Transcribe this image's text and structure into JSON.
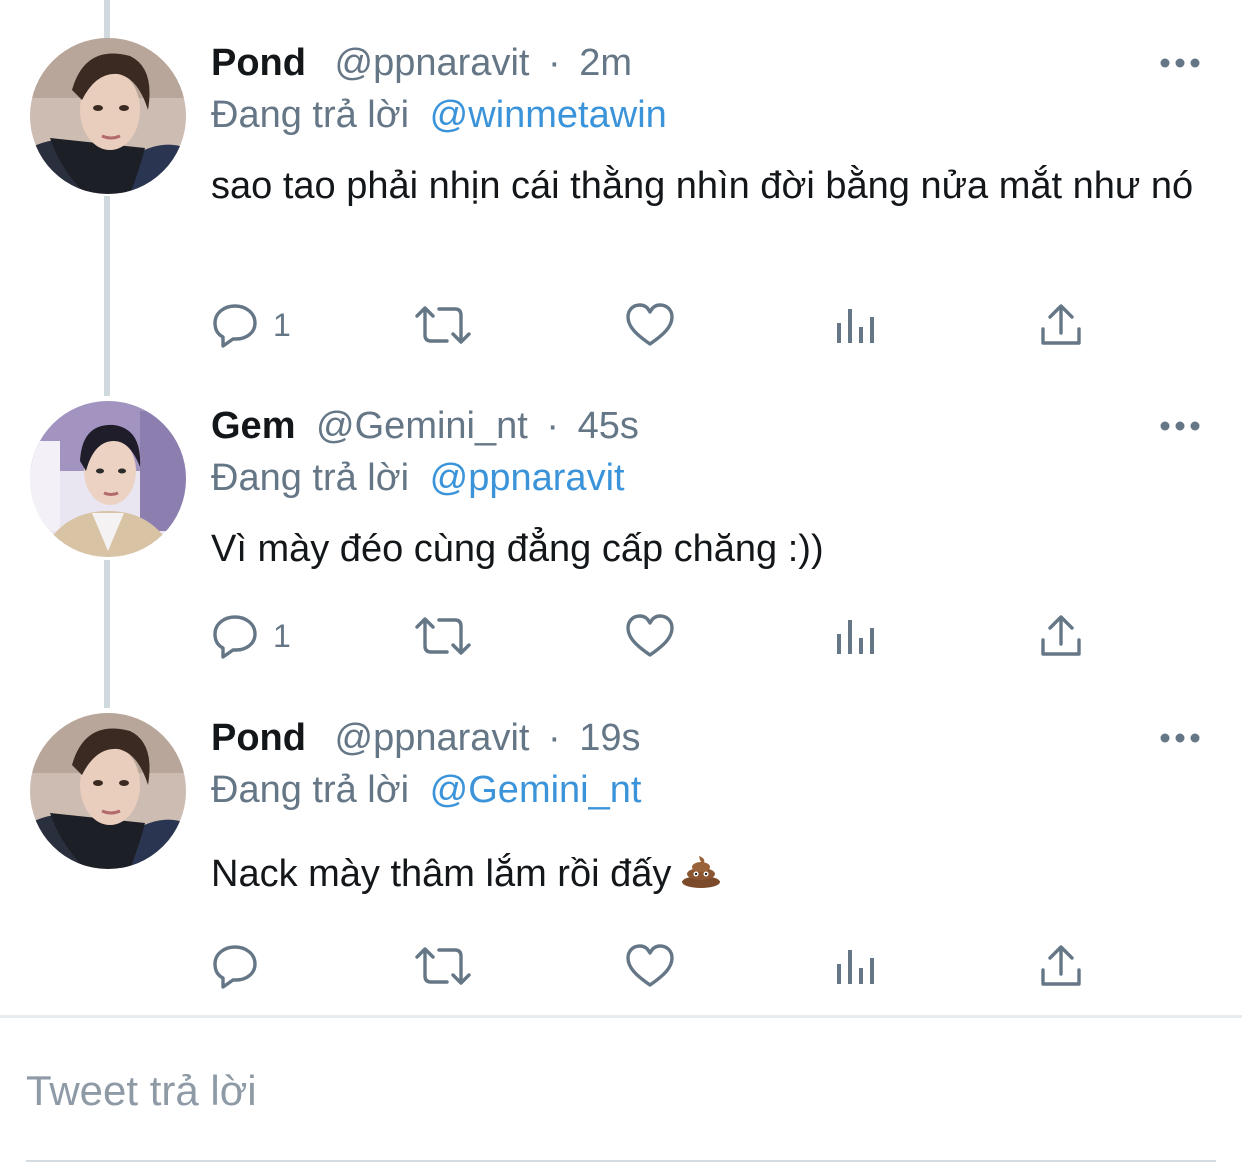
{
  "tweets": [
    {
      "name": "Pond",
      "handle": "@ppnaravit",
      "separator": "·",
      "time": "2m",
      "reply_prefix": "Đang trả lời",
      "reply_to": "@winmetawin",
      "text": "sao tao phải nhịn cái thằng nhìn đời bằng nửa mắt như nó",
      "reply_count": "1",
      "avatar_icon": "avatar-pond"
    },
    {
      "name": "Gem",
      "handle": "@Gemini_nt",
      "separator": "·",
      "time": "45s",
      "reply_prefix": "Đang trả lời",
      "reply_to": "@ppnaravit",
      "text": "Vì mày đéo cùng đẳng cấp chăng :))",
      "reply_count": "1",
      "avatar_icon": "avatar-gem"
    },
    {
      "name": "Pond",
      "handle": "@ppnaravit",
      "separator": "·",
      "time": "19s",
      "reply_prefix": "Đang trả lời",
      "reply_to": "@Gemini_nt",
      "text": "Nack mày thâm lắm rồi đấy",
      "text_emoji": "pile-of-poo-emoji",
      "reply_count": "",
      "avatar_icon": "avatar-pond"
    }
  ],
  "composer": {
    "placeholder": "Tweet trả lời"
  },
  "colors": {
    "link": "#3b94d9",
    "muted": "#657786",
    "thread_line": "#cfd9de"
  }
}
